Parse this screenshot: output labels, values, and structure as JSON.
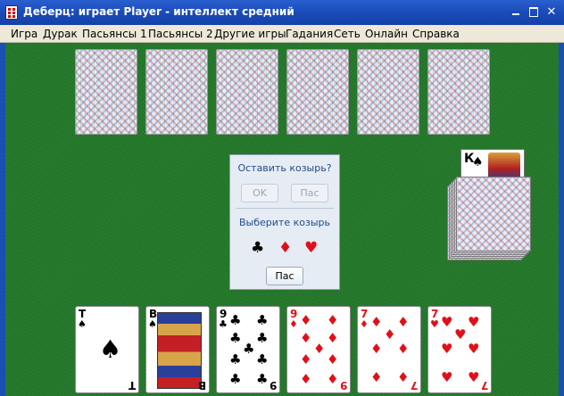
{
  "window": {
    "title": "Деберц: играет Player - интеллект средний",
    "controls": {
      "minimize": "minimize-icon",
      "maximize": "maximize-icon",
      "close": "close-icon"
    }
  },
  "menu": [
    "Игра",
    "Дурак",
    "Пасьянсы 1",
    "Пасьянсы 2",
    "Другие игры",
    "Гадания",
    "Сеть",
    "Онлайн",
    "Справка"
  ],
  "opponent_hand": {
    "card_count": 6
  },
  "trump_card": {
    "rank": "К",
    "suit": "♠"
  },
  "dialog": {
    "keep_trump_question": "Оставить козырь?",
    "ok_label": "OK",
    "pass_label_top": "Пас",
    "choose_trump_label": "Выберите козырь",
    "suit_options": [
      "♣",
      "♦",
      "♥"
    ],
    "pass_label_bottom": "Пас"
  },
  "player_hand": [
    {
      "rank": "Т",
      "suit": "♠",
      "color": "black"
    },
    {
      "rank": "В",
      "suit": "♠",
      "color": "black"
    },
    {
      "rank": "9",
      "suit": "♣",
      "color": "black"
    },
    {
      "rank": "9",
      "suit": "♦",
      "color": "red"
    },
    {
      "rank": "7",
      "suit": "♦",
      "color": "red"
    },
    {
      "rank": "7",
      "suit": "♥",
      "color": "red"
    }
  ],
  "colors": {
    "felt": "#23782a",
    "titlebar": "#1a4bb8",
    "red_suit": "#e0101a"
  }
}
